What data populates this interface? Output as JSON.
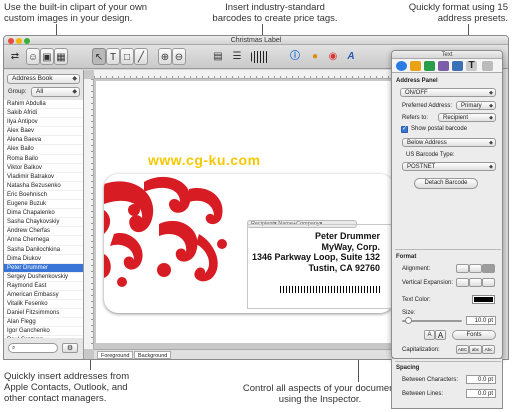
{
  "callouts": {
    "clipart": [
      "Use the built-in clipart of your own",
      "custom images in your design."
    ],
    "barcodes": [
      "Insert industry-standard",
      "barcodes to create price tags."
    ],
    "presets": [
      "Quickly format using 15",
      "address presets."
    ],
    "addresses": [
      "Quickly insert addresses from",
      "Apple Contacts, Outlook, and",
      "other contact managers."
    ],
    "inspector": [
      "Control all aspects of your document",
      "using the Inspector."
    ]
  },
  "window": {
    "title": "Christmas Label"
  },
  "sidebar": {
    "source": "Address Book",
    "group_label": "Group:",
    "group_value": "All",
    "contacts": [
      "Rahim Abdulla",
      "Sakib Afridi",
      "Ilya Antipov",
      "Alex Baev",
      "Alena Baeva",
      "Alex Bailo",
      "Roma Bailo",
      "Viktor Balkov",
      "Vladimir Batrakov",
      "Natasha Bezusenko",
      "Eric Boehnisch",
      "Eugene Buzuk",
      "Dima Chapalenko",
      "Sasha Chaykovskiy",
      "Andrew Cherfas",
      "Anna Chernega",
      "Sasha Danilochkina",
      "Dima Diukov",
      "Peter Drummer",
      "Sergey Dushenkovskiy",
      "Raymond East",
      "American Embassy",
      "Vitalik Fesenko",
      "Daniel Fitzsimmons",
      "Alan Flegg",
      "Igor Ganchenko",
      "Paul Grozyan"
    ],
    "selected": "Peter Drummer"
  },
  "label": {
    "chips": "Recipient▾        Name+Company▾",
    "address": [
      "Peter Drummer",
      "MyWay, Corp.",
      "1346 Parkway Loop, Suite 132",
      "Tustin, CA 92760"
    ],
    "watermark": "www.cg-ku.com"
  },
  "canvas_tabs": [
    "Foreground",
    "Background"
  ],
  "inspector": {
    "title": "Text",
    "address_panel": {
      "heading": "Address Panel",
      "toggle": "ON/OFF",
      "preferred_label": "Preferred Address:",
      "preferred_value": "Primary",
      "refers_label": "Refers to:",
      "refers_value": "Recipient",
      "show_barcode": "Show postal barcode",
      "position": "Below Address",
      "barcode_type_label": "US Barcode Type:",
      "barcode_type": "POSTNET",
      "detach": "Detach Barcode"
    },
    "format": {
      "heading": "Format",
      "alignment": "Alignment:",
      "vertical": "Vertical Expansion:",
      "text_color": "Text Color:",
      "size_label": "Size:",
      "size_value": "10.0 pt",
      "fonts": "Fonts",
      "capitalization": "Capitalization:",
      "cap_options": [
        "ABC",
        "abc",
        "Abc"
      ]
    },
    "spacing": {
      "heading": "Spacing",
      "between_chars": "Between Characters:",
      "between_chars_value": "0.0 pt",
      "between_lines": "Between Lines:",
      "between_lines_value": "0.0 pt"
    }
  },
  "colors": {
    "accent": "#3875d7",
    "flourish": "#d81c24",
    "text_color_swatch": "#000000"
  }
}
